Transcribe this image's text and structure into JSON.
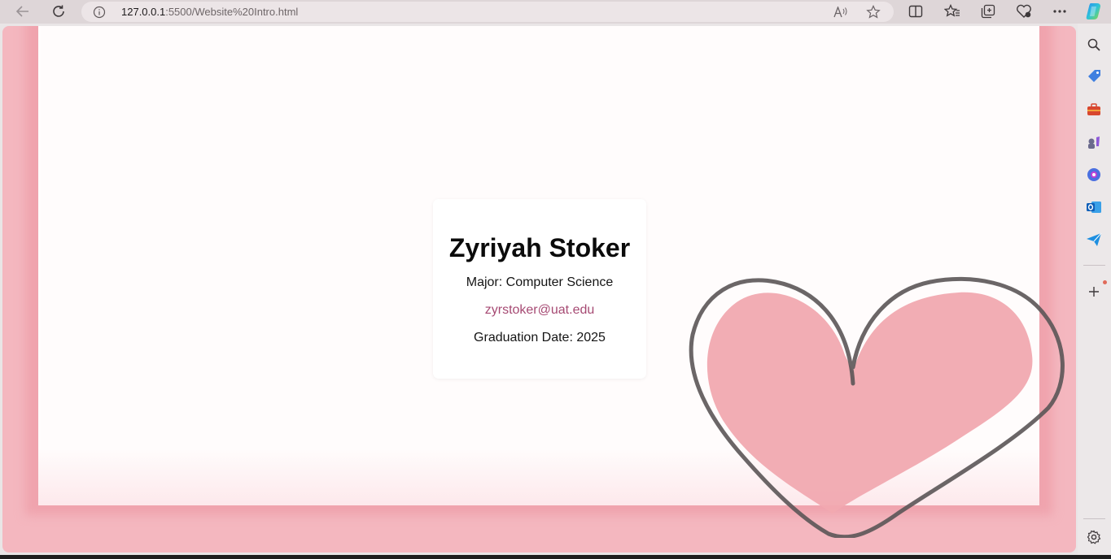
{
  "browser": {
    "url_host": "127.0.0.1",
    "url_path": ":5500/Website%20Intro.html",
    "nav_icons": [
      "back-arrow-icon",
      "refresh-icon"
    ],
    "address_icons": [
      "site-info-icon",
      "read-aloud-icon",
      "favorite-star-icon"
    ],
    "toolbar_icons": [
      "split-screen-icon",
      "favorites-icon",
      "collections-icon",
      "browser-essentials-icon",
      "more-menu-icon",
      "copilot-icon"
    ],
    "sidebar_icons": [
      "search-icon",
      "shopping-tag-icon",
      "tools-icon",
      "games-icon",
      "microsoft-365-icon",
      "outlook-icon",
      "send-icon",
      "add-icon",
      "settings-icon"
    ]
  },
  "page": {
    "name": "Zyriyah Stoker",
    "major": "Major: Computer Science",
    "email": "zyrstoker@uat.edu",
    "graduation": "Graduation Date: 2025"
  },
  "colors": {
    "frame_pink": "#f4b7bf",
    "heart_fill": "#f1a9b0",
    "heart_outline": "#5b5556",
    "link": "#a64a73"
  }
}
